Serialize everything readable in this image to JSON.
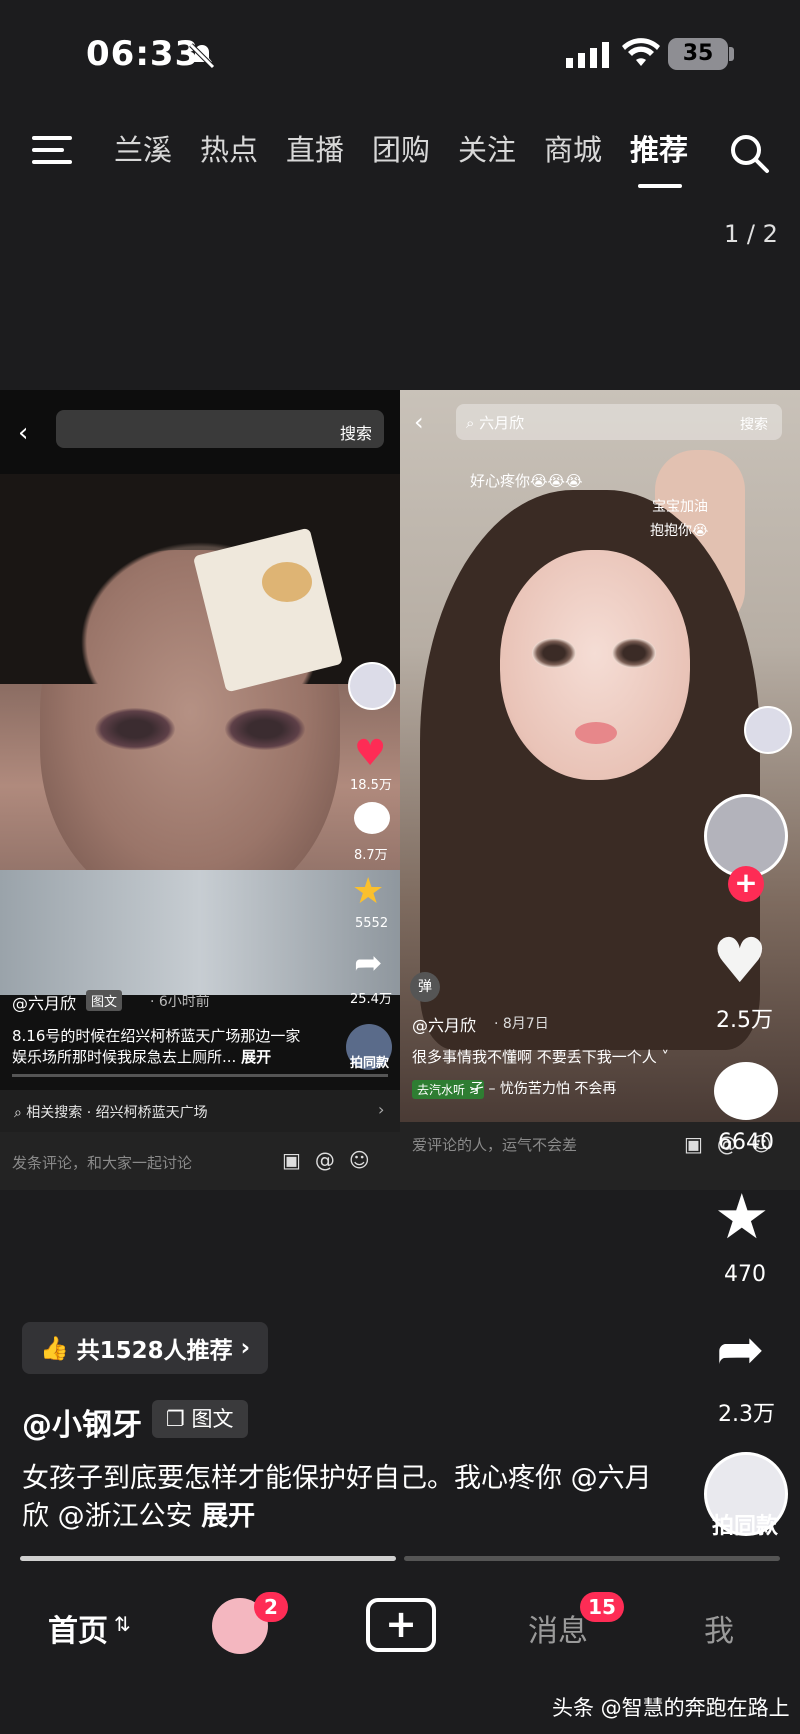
{
  "status_bar": {
    "time": "06:33",
    "battery": "35"
  },
  "top_nav": {
    "tabs": [
      "兰溪",
      "热点",
      "直播",
      "团购",
      "关注",
      "商城",
      "推荐"
    ],
    "active_tab": "推荐",
    "page_indicator": "1 / 2"
  },
  "left_post": {
    "search_button": "搜索",
    "likes": "18.5万",
    "comments": "8.7万",
    "favorites": "5552",
    "shares": "25.4万",
    "author": "@六月欣",
    "badge": "图文",
    "time": "· 6小时前",
    "description": "8.16号的时候在绍兴柯桥蓝天广场那边一家娱乐场所那时候我尿急去上厕所...",
    "expand": "展开",
    "pai_label": "拍同款",
    "related_search": "相关搜索 · 绍兴柯桥蓝天广场",
    "comment_placeholder": "发条评论，和大家一起讨论",
    "comment_icons": "▣@☺"
  },
  "right_post": {
    "search_text": "六月欣",
    "search_button": "搜索",
    "danmu": [
      "好心疼你😭😭😭",
      "宝宝加油",
      "抱抱你😭"
    ],
    "pin_label": "弹",
    "author": "@六月欣",
    "date": "· 8月7日",
    "description": "很多事情我不懂啊 不要丢下我一个人 ˅",
    "music_tag": "去汽水听 >",
    "music": "孑 – 忧伤苦力怕   不会再",
    "comment_placeholder": "爱评论的人，运气不会差",
    "comment_icons": "▣@☺"
  },
  "right_rail": {
    "likes": "2.5万",
    "comments": "6640",
    "favorites": "470",
    "shares": "2.3万",
    "pai_label": "拍同款"
  },
  "main_post": {
    "recommend": "共1528人推荐",
    "author": "@小钢牙",
    "badge": "图文",
    "description": "女孩子到底要怎样才能保护好自己。我心疼你 @六月欣 @浙江公安",
    "expand": "展开"
  },
  "tab_bar": {
    "home": "首页",
    "friends_badge": "2",
    "messages": "消息",
    "messages_badge": "15",
    "me": "我"
  },
  "watermark": "头条 @智慧的奔跑在路上"
}
